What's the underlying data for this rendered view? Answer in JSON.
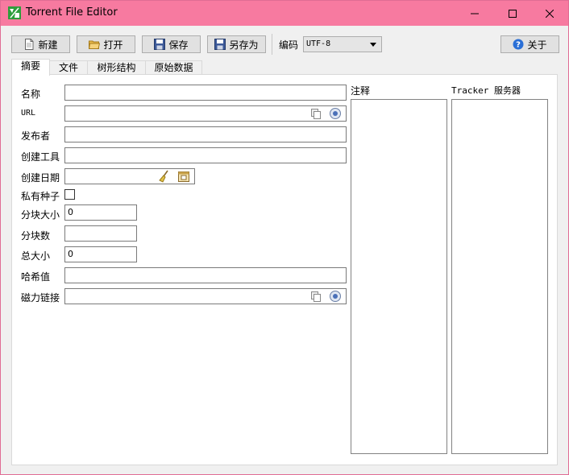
{
  "window": {
    "title": "Torrent File Editor",
    "controls": {
      "minimize": "minimize-icon",
      "maximize": "maximize-icon",
      "close": "close-icon"
    },
    "accent_color": "#f77aa0"
  },
  "toolbar": {
    "new_label": "新建",
    "open_label": "打开",
    "save_label": "保存",
    "save_as_label": "另存为",
    "encoding_label": "编码",
    "encoding_value": "UTF-8",
    "about_label": "关于"
  },
  "tabs": [
    {
      "label": "摘要",
      "active": true
    },
    {
      "label": "文件",
      "active": false
    },
    {
      "label": "树形结构",
      "active": false
    },
    {
      "label": "原始数据",
      "active": false
    }
  ],
  "summary": {
    "name_label": "名称",
    "name_value": "",
    "url_label": "URL",
    "url_value": "",
    "publisher_label": "发布者",
    "publisher_value": "",
    "created_by_label": "创建工具",
    "created_by_value": "",
    "creation_date_label": "创建日期",
    "creation_date_value": "",
    "private_label": "私有种子",
    "private_checked": false,
    "piece_size_label": "分块大小",
    "piece_size_value": "0",
    "pieces_label": "分块数",
    "pieces_value": "",
    "total_size_label": "总大小",
    "total_size_value": "0",
    "hash_label": "哈希值",
    "hash_value": "",
    "magnet_label": "磁力链接",
    "magnet_value": ""
  },
  "comment": {
    "label": "注释",
    "value": ""
  },
  "trackers": {
    "label": "Tracker 服务器",
    "items": []
  }
}
